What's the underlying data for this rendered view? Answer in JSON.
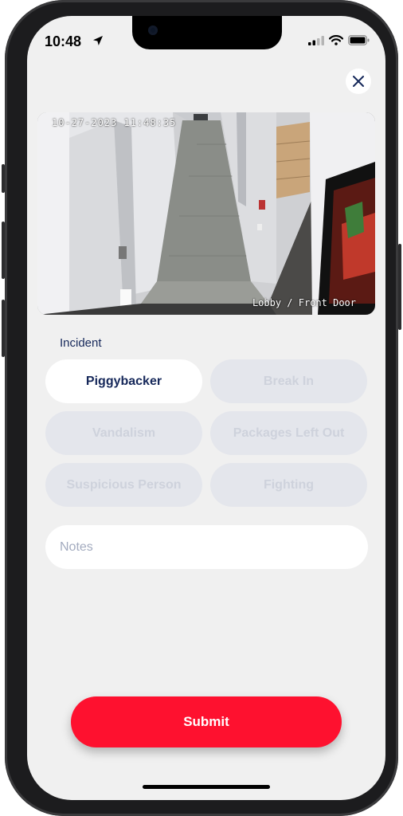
{
  "status_bar": {
    "time": "10:48"
  },
  "video": {
    "timestamp": "10-27-2023 11:48:35",
    "camera_name": "Lobby / Front Door"
  },
  "incident": {
    "label": "Incident",
    "options": [
      "Piggybacker",
      "Break In",
      "Vandalism",
      "Packages Left Out",
      "Suspicious Person",
      "Fighting"
    ],
    "selected": "Piggybacker"
  },
  "notes": {
    "placeholder": "Notes"
  },
  "submit": {
    "label": "Submit"
  },
  "colors": {
    "accent_red": "#fe112f",
    "navy": "#16285a",
    "chip_inactive": "#e4e6ec",
    "background": "#f0f0f0"
  }
}
